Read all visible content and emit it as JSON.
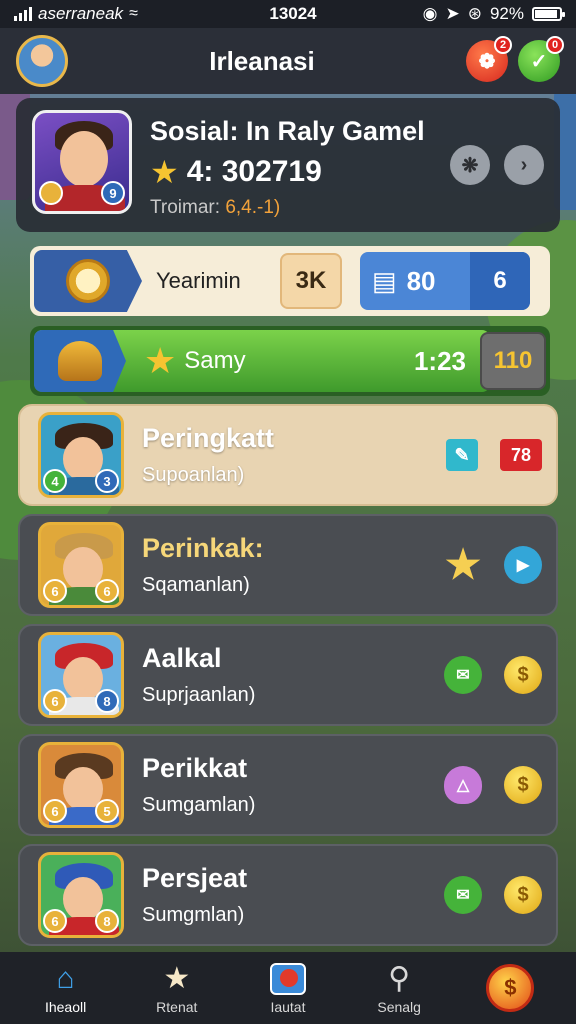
{
  "status_bar": {
    "carrier": "aserraneak",
    "time": "13024",
    "battery": "92%",
    "battery_level": 0.92
  },
  "header": {
    "title": "Irleanasi",
    "notif_badge": "2",
    "check_badge": "0"
  },
  "profile": {
    "name": "Sosial: In Raly Gamel",
    "score": "4: 302719",
    "subtitle_prefix": "Troimar:",
    "subtitle_value": "6,4.-1)",
    "level_badge": "9"
  },
  "resource": {
    "label": "Yearimin",
    "chip_value": "3K",
    "count_value": "80",
    "tail_value": "6"
  },
  "progress": {
    "label": "Samy",
    "time": "1:23",
    "chip_value": "110",
    "fill_fraction": 0.89
  },
  "list_items": [
    {
      "title": "Peringkatt",
      "subtitle": "Supoanlan)",
      "badge_a": "4",
      "badge_b": "3",
      "right_value": "78"
    },
    {
      "title": "Perinkak:",
      "subtitle": "Sqamanlan)",
      "badge_a": "6",
      "badge_b": "6"
    },
    {
      "title": "Aalkal",
      "subtitle": "Suprjaanlan)",
      "badge_a": "6",
      "badge_b": "8"
    },
    {
      "title": "Perikkat",
      "subtitle": "Sumgamlan)",
      "badge_a": "6",
      "badge_b": "5"
    },
    {
      "title": "Persjeat",
      "subtitle": "Sumgmlan)",
      "badge_a": "6",
      "badge_b": "8"
    }
  ],
  "nav": {
    "items": [
      {
        "label": "Iheaoll"
      },
      {
        "label": "Rtenat"
      },
      {
        "label": "Iautat"
      },
      {
        "label": "Senalg"
      }
    ]
  },
  "colors": {
    "accent_green": "#45b33a",
    "accent_blue": "#4b86d6",
    "gold": "#f6c431",
    "red": "#d8262a"
  }
}
